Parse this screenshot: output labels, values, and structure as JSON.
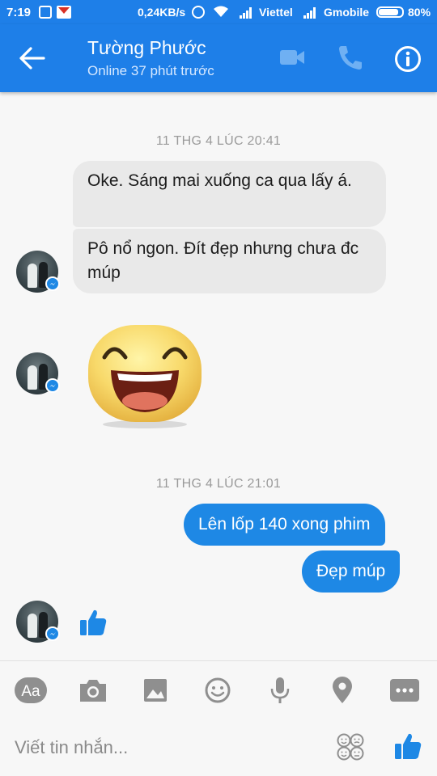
{
  "status_bar": {
    "time": "7:19",
    "data_rate": "0,24KB/s",
    "carrier1": "Viettel",
    "carrier2": "Gmobile",
    "battery": "80%",
    "background_color": "#1e7fe8"
  },
  "header": {
    "contact_name": "Tường Phước",
    "contact_status": "Online 37 phút trước",
    "back_icon": "arrow-left-icon",
    "video_icon": "video-camera-icon",
    "call_icon": "phone-icon",
    "info_icon": "info-icon",
    "color": "#1e7fe8"
  },
  "conversation": {
    "timestamp1": "11 THG 4 LÚC 20:41",
    "timestamp2": "11 THG 4 LÚC 21:01",
    "incoming": [
      {
        "text": "Oke. Sáng mai xuống ca qua lấy á."
      },
      {
        "text": "Pô nổ ngon. Đít đẹp nhưng chưa đc múp"
      }
    ],
    "incoming_sticker": "laughing-face-sticker",
    "outgoing": [
      {
        "text": "Lên lốp 140 xong phim"
      },
      {
        "text": "Đẹp múp"
      }
    ],
    "incoming_like": "thumbs-up-icon",
    "outgoing_bubble_color": "#1e88e5",
    "incoming_bubble_color": "#e9e9e9"
  },
  "toolbar": {
    "aa_label": "Aa",
    "icons": [
      "camera-icon",
      "image-icon",
      "emoji-icon",
      "microphone-icon",
      "location-icon",
      "more-icon"
    ]
  },
  "composer": {
    "placeholder": "Viết tin nhắn...",
    "sticker_icon": "sticker-faces-icon",
    "like_icon": "thumbs-up-icon"
  }
}
